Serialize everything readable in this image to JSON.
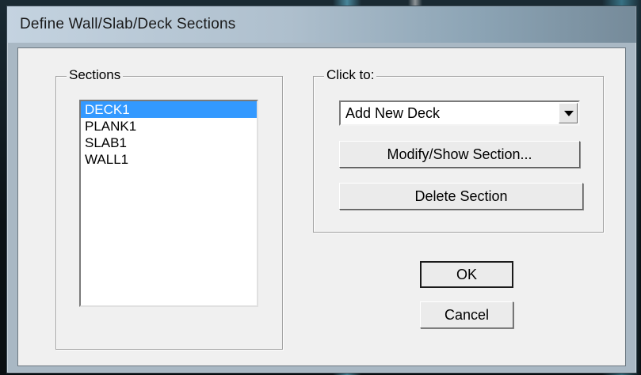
{
  "window": {
    "title": "Define Wall/Slab/Deck Sections"
  },
  "sections": {
    "label": "Sections",
    "items": [
      "DECK1",
      "PLANK1",
      "SLAB1",
      "WALL1"
    ],
    "selected_index": 0
  },
  "click_to": {
    "label": "Click to:",
    "dropdown_value": "Add New Deck",
    "modify_label": "Modify/Show Section...",
    "delete_label": "Delete Section"
  },
  "buttons": {
    "ok_label": "OK",
    "cancel_label": "Cancel"
  },
  "colors": {
    "selection": "#3399ff",
    "dialog_bg": "#f0f0f0"
  },
  "icons": {
    "dropdown": "chevron-down-icon"
  }
}
